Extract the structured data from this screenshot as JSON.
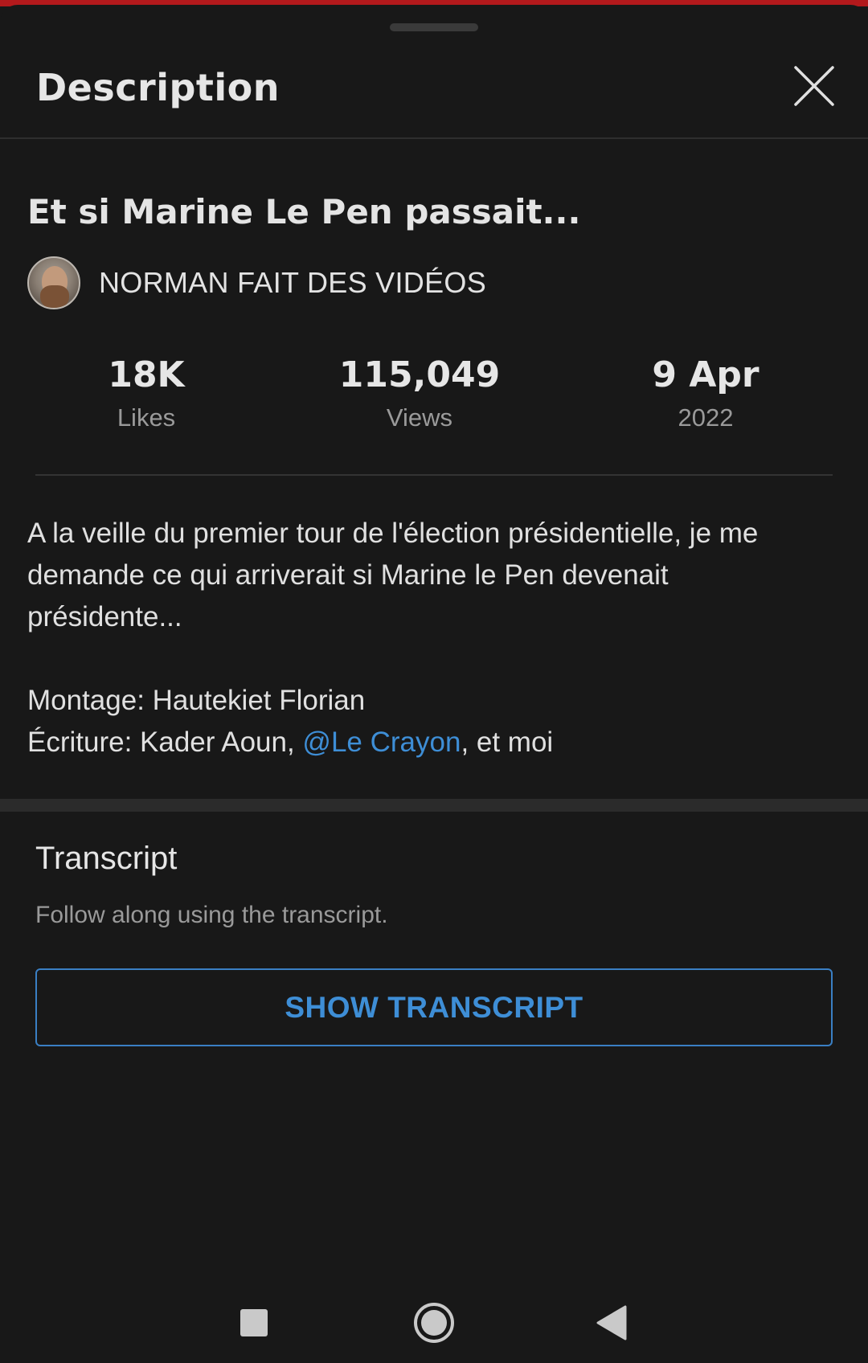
{
  "header": {
    "title": "Description",
    "close_icon": "close-icon"
  },
  "video": {
    "title": "Et si Marine Le Pen passait...",
    "channel": {
      "name": "NORMAN FAIT DES VIDÉOS",
      "avatar_icon": "avatar"
    }
  },
  "stats": {
    "likes": {
      "value": "18K",
      "label": "Likes"
    },
    "views": {
      "value": "115,049",
      "label": "Views"
    },
    "date": {
      "value": "9 Apr",
      "label": "2022"
    }
  },
  "description": {
    "line1": "A la veille du premier tour de l'élection présidentielle, je me",
    "line2": "demande ce qui arriverait si Marine le Pen devenait",
    "line3": "présidente...",
    "montage": "Montage: Hautekiet Florian",
    "ecriture_prefix": "Écriture: Kader Aoun, ",
    "ecriture_mention": "@Le Crayon",
    "ecriture_suffix": ", et moi"
  },
  "transcript": {
    "title": "Transcript",
    "subtitle": "Follow along using the transcript.",
    "button_label": "SHOW TRANSCRIPT"
  },
  "system_nav": {
    "recents_icon": "square-icon",
    "home_icon": "circle-icon",
    "back_icon": "triangle-back-icon"
  },
  "colors": {
    "background": "#181818",
    "accent_link": "#3e8ed6",
    "top_strip": "#b3191c"
  }
}
